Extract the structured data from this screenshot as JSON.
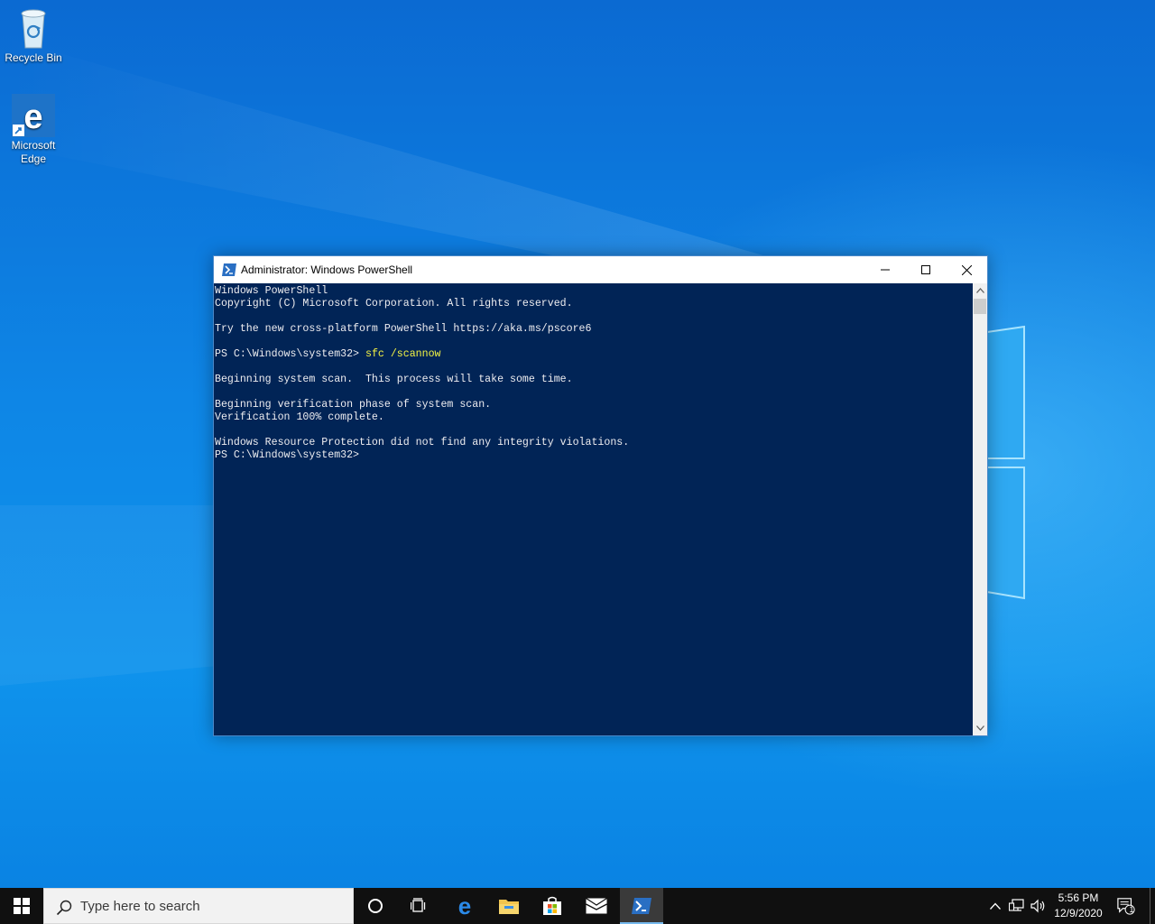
{
  "desktop": {
    "icons": [
      {
        "label": "Recycle Bin",
        "icon": "recycle-bin-icon"
      },
      {
        "label": "Microsoft\nEdge",
        "icon": "edge-icon"
      }
    ]
  },
  "window": {
    "title": "Administrator: Windows PowerShell",
    "icon": "powershell-icon",
    "controls": {
      "minimize": "minimize-icon",
      "maximize": "maximize-icon",
      "close": "close-icon"
    },
    "console": {
      "line1": "Windows PowerShell",
      "line2": "Copyright (C) Microsoft Corporation. All rights reserved.",
      "line3": "Try the new cross-platform PowerShell https://aka.ms/pscore6",
      "prompt": "PS C:\\Windows\\system32>",
      "command": "sfc /scannow",
      "line5": "Beginning system scan.  This process will take some time.",
      "line6": "Beginning verification phase of system scan.",
      "line7": "Verification 100% complete.",
      "line8": "Windows Resource Protection did not find any integrity violations.",
      "final_prompt": "PS C:\\Windows\\system32>"
    },
    "colors": {
      "console_bg": "#012456",
      "console_fg": "#eeedf0",
      "command_fg": "#f5f543"
    }
  },
  "taskbar": {
    "search_placeholder": "Type here to search",
    "pinned": [
      "start-icon",
      "cortana-icon",
      "task-view-icon",
      "edge-icon",
      "file-explorer-icon",
      "store-icon",
      "mail-icon",
      "powershell-icon"
    ],
    "tray": {
      "clock_time": "5:56 PM",
      "clock_date": "12/9/2020",
      "notification_count": "1"
    }
  }
}
